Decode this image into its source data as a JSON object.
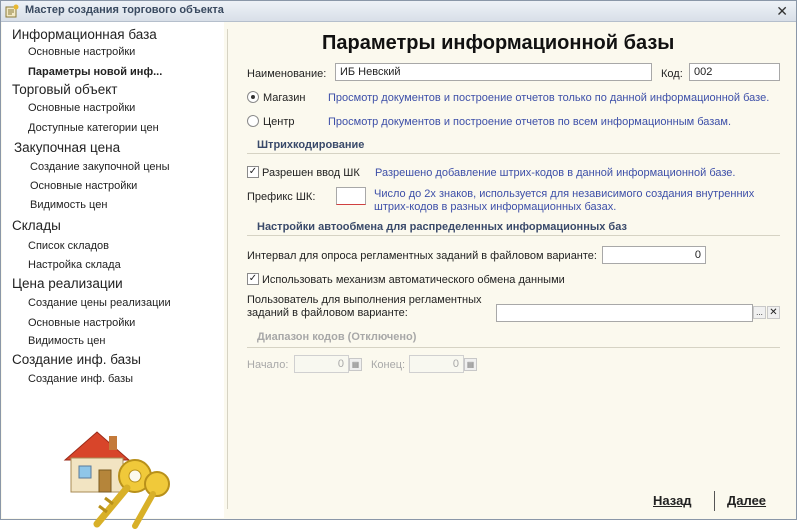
{
  "window": {
    "title": "Мастер создания торгового объекта"
  },
  "sidebar": {
    "groups": [
      {
        "label": "Информационная база",
        "items": [
          "Основные настройки",
          "Параметры новой инф..."
        ]
      },
      {
        "label": "Торговый объект",
        "items": [
          "Основные настройки",
          "Доступные категории цен"
        ]
      },
      {
        "label": "Закупочная цена",
        "items": [
          "Создание закупочной цены",
          "Основные настройки",
          "Видимость цен"
        ]
      },
      {
        "label": "Склады",
        "items": [
          "Список складов",
          "Настройка склада"
        ]
      },
      {
        "label": "Цена реализации",
        "items": [
          "Создание цены реализации",
          "Основные настройки",
          "Видимость цен"
        ]
      },
      {
        "label": "Создание инф. базы",
        "items": [
          "Создание инф. базы"
        ]
      }
    ]
  },
  "main": {
    "title": "Параметры информационной базы",
    "name_label": "Наименование:",
    "name_value": "ИБ Невский",
    "code_label": "Код:",
    "code_value": "002",
    "radio_shop": "Магазин",
    "radio_shop_hint": "Просмотр документов и построение отчетов только по данной информационной базе.",
    "radio_center": "Центр",
    "radio_center_hint": "Просмотр документов и построение отчетов по всем информационным базам.",
    "barcode_section": "Штрихкодирование",
    "barcode_check": "Разрешен ввод ШК",
    "barcode_check_hint": "Разрешено добавление штрих-кодов в данной информационной базе.",
    "prefix_label": "Префикс ШК:",
    "prefix_value": "",
    "prefix_hint": "Число до 2х знаков, используется для независимого создания внутренних штрих-кодов в разных информационных базах.",
    "autoexchange_section": "Настройки автообмена для распределенных информационных баз",
    "interval_label": "Интервал для опроса регламентных заданий в файловом варианте:",
    "interval_value": "0",
    "use_auto_label": "Использовать механизм автоматического обмена данными",
    "user_label": "Пользователь для выполнения регламентных заданий в файловом варианте:",
    "user_value": "",
    "codes_section": "Диапазон кодов (Отключено)",
    "start_label": "Начало:",
    "start_value": "0",
    "end_label": "Конец:",
    "end_value": "0",
    "back_button": "Назад",
    "next_button": "Далее"
  }
}
